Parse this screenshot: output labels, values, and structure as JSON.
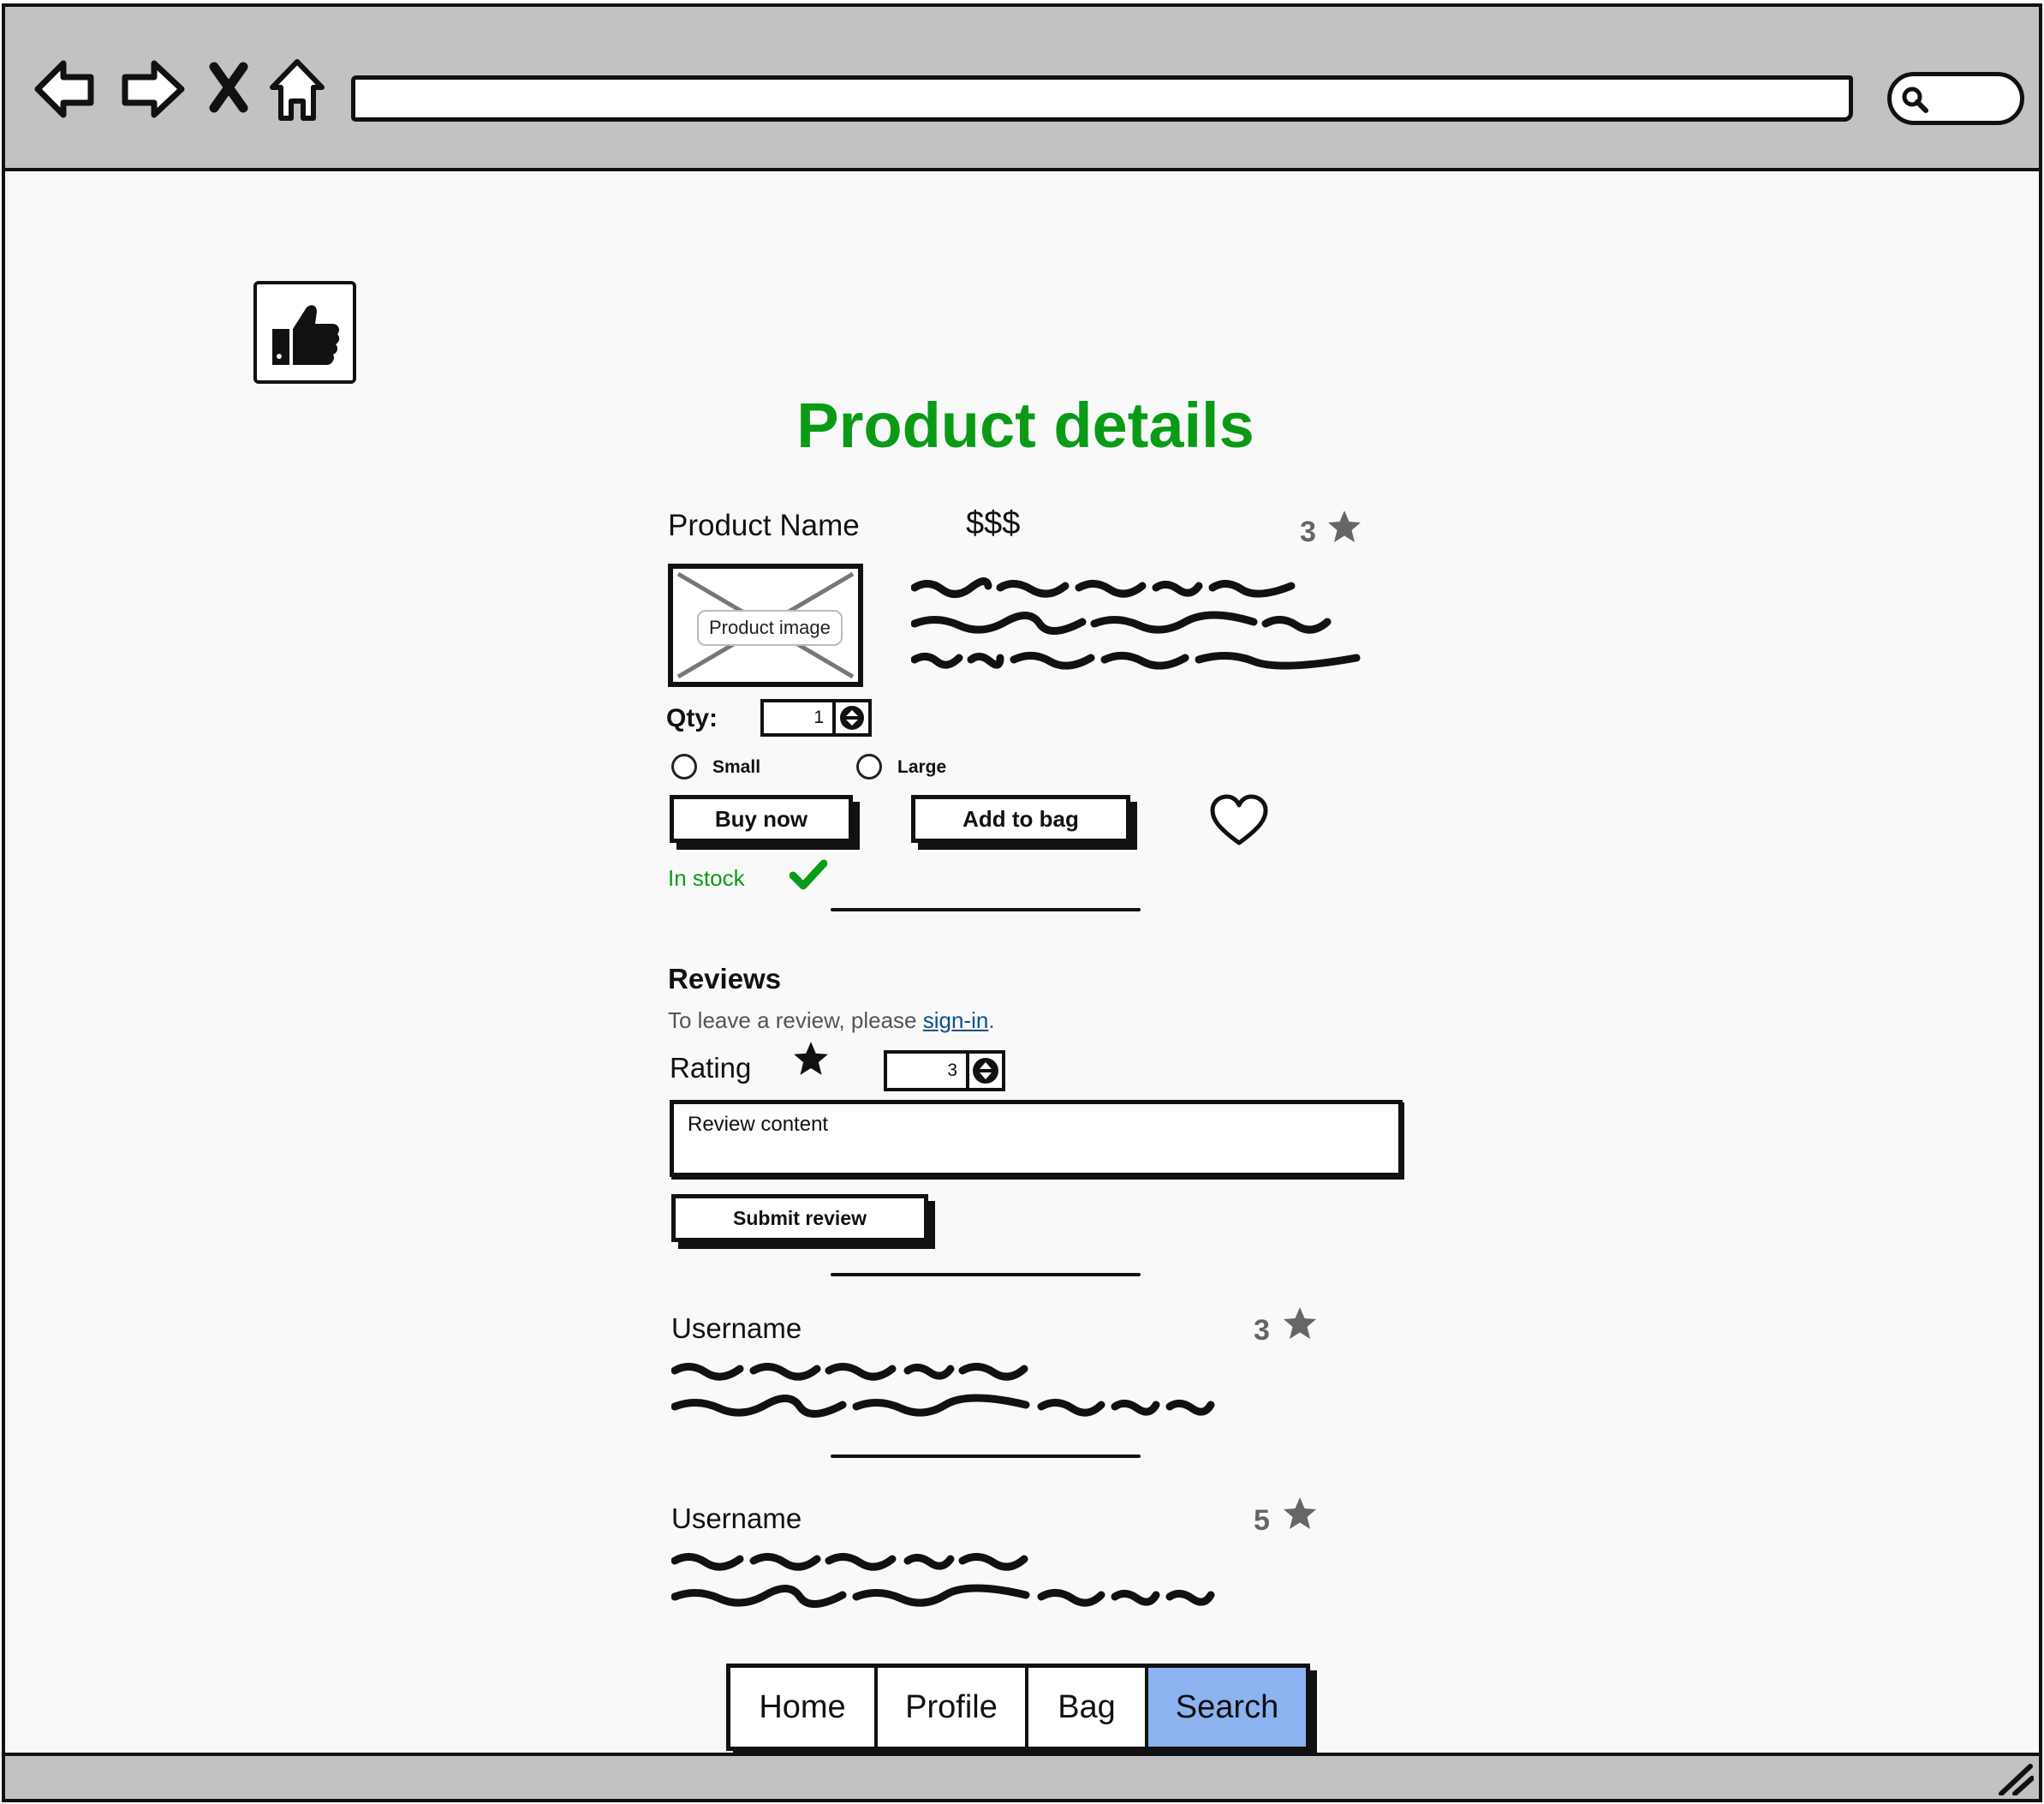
{
  "browser": {
    "back_icon": "back-arrow-icon",
    "forward_icon": "forward-arrow-icon",
    "stop_icon": "close-icon",
    "home_icon": "home-icon",
    "url_value": "",
    "search_icon": "search-icon"
  },
  "header": {
    "logo_icon": "thumbs-up-icon",
    "title": "Product details"
  },
  "product": {
    "name": "Product Name",
    "price": "$$$",
    "rating": "3",
    "image_label": "Product image",
    "qty_label": "Qty:",
    "qty_value": "1",
    "sizes": [
      "Small",
      "Large"
    ],
    "buy_label": "Buy now",
    "add_label": "Add to bag",
    "stock_text": "In stock"
  },
  "reviews": {
    "heading": "Reviews",
    "signin_prefix": "To leave a review, please ",
    "signin_link": "sign-in",
    "signin_suffix": ".",
    "rating_label": "Rating",
    "rating_value": "3",
    "content_placeholder": "Review content",
    "submit_label": "Submit review",
    "items": [
      {
        "username": "Username",
        "rating": "3"
      },
      {
        "username": "Username",
        "rating": "5"
      }
    ]
  },
  "nav": {
    "items": [
      "Home",
      "Profile",
      "Bag",
      "Search"
    ],
    "active": "Search"
  },
  "colors": {
    "accent_green": "#0a9b16",
    "nav_active": "#8cb3f0",
    "link_blue": "#0b4f8a",
    "chrome_grey": "#c2c2c2"
  }
}
